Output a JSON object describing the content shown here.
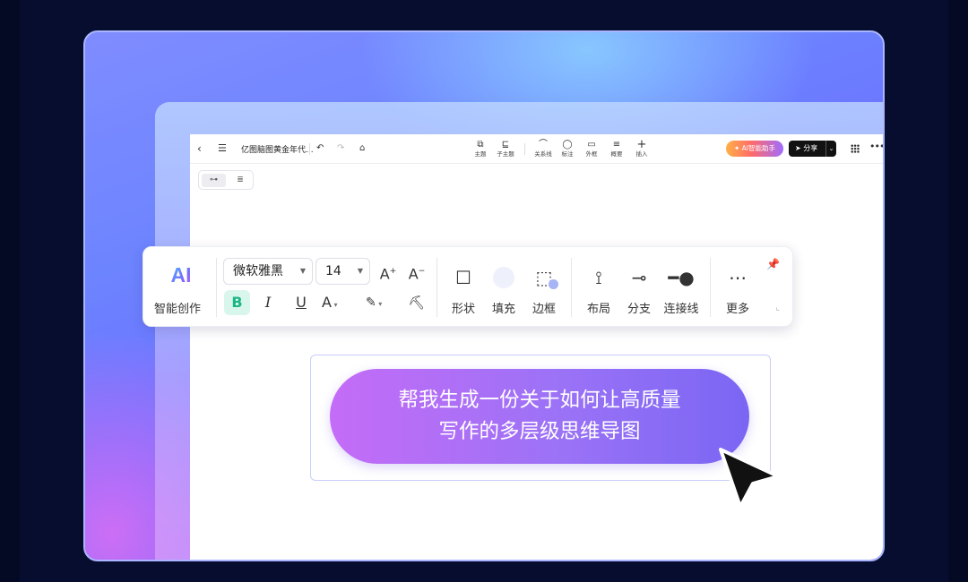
{
  "app": {
    "doc_title": "亿图脑图黄金年代...",
    "ai_assistant_label": "AI智能助手",
    "share_label": "分享"
  },
  "topbar_tools": [
    {
      "icon": "topic-icon",
      "label": "主题"
    },
    {
      "icon": "subtopic-icon",
      "label": "子主题"
    },
    {
      "icon": "relation-icon",
      "label": "关系线"
    },
    {
      "icon": "callout-icon",
      "label": "标注"
    },
    {
      "icon": "boundary-icon",
      "label": "外框"
    },
    {
      "icon": "summary-icon",
      "label": "概要"
    },
    {
      "icon": "insert-icon",
      "label": "插入"
    }
  ],
  "format_toolbar": {
    "ai_logo": "AI",
    "ai_label": "智能创作",
    "font_family": "微软雅黑",
    "font_size": "14",
    "increase_font": "A",
    "decrease_font": "A",
    "bold": "B",
    "italic": "I",
    "underline": "U",
    "font_color": "A",
    "tools": [
      {
        "icon": "shape-icon",
        "label": "形状"
      },
      {
        "icon": "fill-icon",
        "label": "填充"
      },
      {
        "icon": "border-icon",
        "label": "边框"
      },
      {
        "icon": "layout-icon",
        "label": "布局"
      },
      {
        "icon": "branch-icon",
        "label": "分支"
      },
      {
        "icon": "connector-icon",
        "label": "连接线"
      },
      {
        "icon": "more-icon",
        "label": "更多"
      }
    ]
  },
  "prompt": {
    "line1": "帮我生成一份关于如何让高质量",
    "line2": "写作的多层级思维导图"
  },
  "colors": {
    "accent_green": "#1bb685",
    "bubble_start": "#c46cf7",
    "bubble_end": "#7a66f4"
  }
}
